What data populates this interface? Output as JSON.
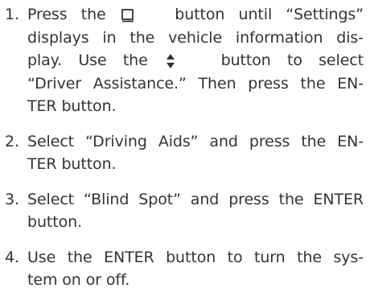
{
  "steps": [
    {
      "number": "1.",
      "line1_a": "Press the",
      "icon1": "page-button-icon",
      "line1_b": "button until “Settings”",
      "line2": "displays in the vehicle information dis-",
      "line3_a": "play. Use the",
      "icon2": "up-down-arrow-icon",
      "line3_b": "button to select",
      "line4": "“Driver Assistance.” Then press the EN-",
      "line5": "TER button."
    },
    {
      "number": "2.",
      "line1": "Select “Driving Aids” and press the EN-",
      "line2": "TER button."
    },
    {
      "number": "3.",
      "line1": "Select “Blind Spot” and press the ENTER",
      "line2": "button."
    },
    {
      "number": "4.",
      "line1": "Use the ENTER button to turn the sys-",
      "line2": "tem on or off."
    }
  ]
}
